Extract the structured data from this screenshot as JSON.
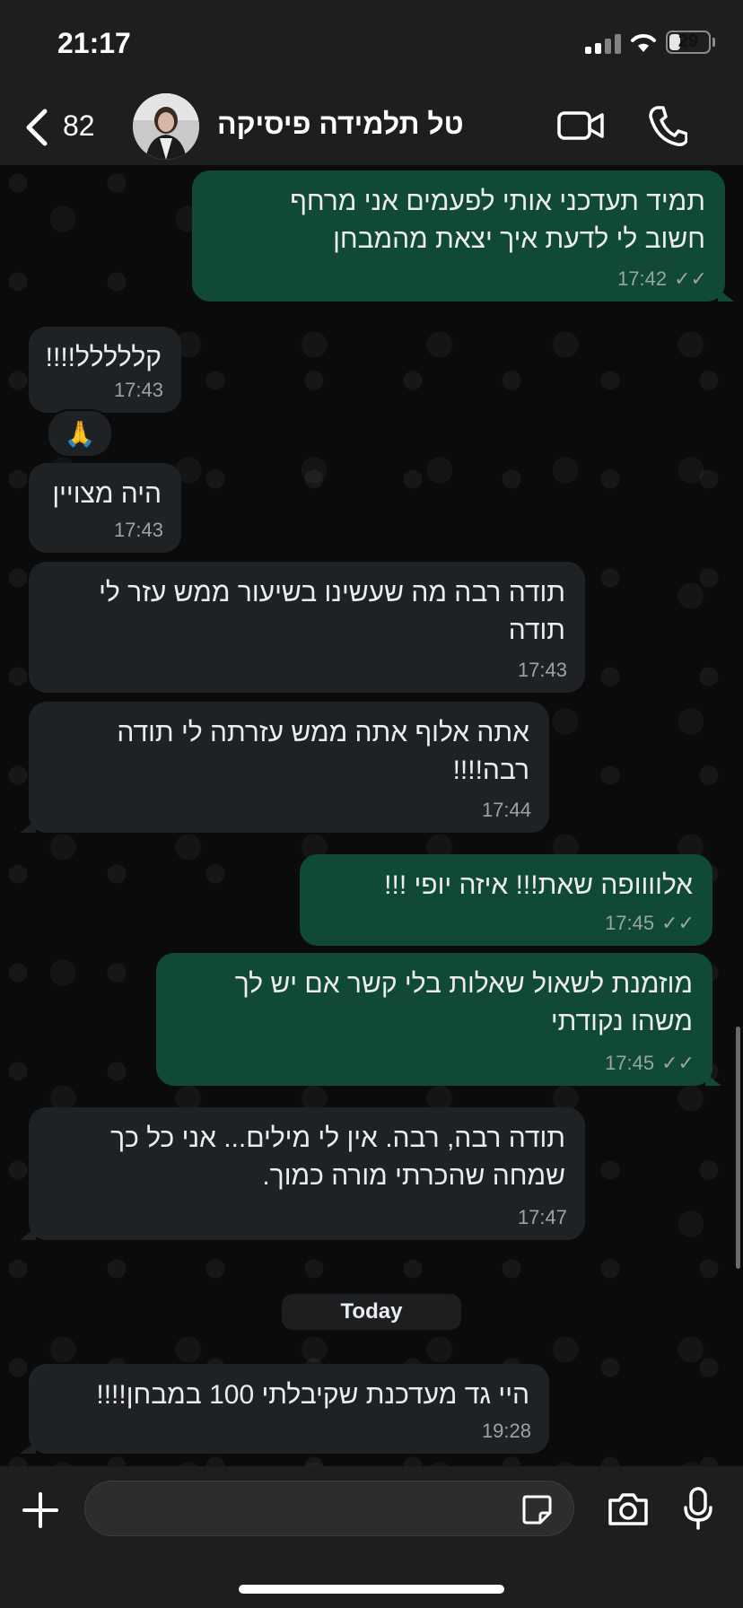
{
  "status_bar": {
    "time": "21:17",
    "battery": "29",
    "battery_level": 0.29
  },
  "header": {
    "back_count": "82",
    "contact_name": "טל תלמידה פיסיקה"
  },
  "messages": [
    {
      "direction": "out",
      "text": "תמיד תעדכני אותי לפעמים אני מרחף\nחשוב לי לדעת איך יצאת מהמבחן",
      "time": "17:42",
      "status": "read"
    },
    {
      "direction": "in",
      "text": "קללללל!!!!",
      "time": "17:43",
      "reaction": "🙏"
    },
    {
      "direction": "in",
      "text": "היה מצויין",
      "time": "17:43"
    },
    {
      "direction": "in",
      "text": "תודה רבה מה שעשינו בשיעור ממש עזר לי\nתודה",
      "time": "17:43"
    },
    {
      "direction": "in",
      "text": "אתה אלוף אתה ממש עזרתה לי תודה\nרבה!!!!",
      "time": "17:44"
    },
    {
      "direction": "out",
      "text": "אלוווופה שאת!!! איזה יופי !!!",
      "time": "17:45",
      "status": "read"
    },
    {
      "direction": "out",
      "text": "מוזמנת לשאול שאלות בלי קשר אם יש לך\nמשהו נקודתי",
      "time": "17:45",
      "status": "read"
    },
    {
      "direction": "in",
      "text": "תודה רבה, רבה. אין לי מילים... אני כל כך\nשמחה שהכרתי מורה כמוך.",
      "time": "17:47"
    },
    {
      "direction": "in",
      "text": "היי גד מעדכנת שקיבלתי 100 במבחן!!!!",
      "time": "19:28"
    }
  ],
  "date_separator": "Today",
  "colors": {
    "outgoing_bubble": "#104934",
    "incoming_bubble": "#1f2224",
    "bar_background": "#1c1e1f"
  },
  "icons": {
    "back": "chevron-left-icon",
    "video": "video-camera-icon",
    "phone": "phone-icon",
    "plus": "plus-icon",
    "sticker": "sticker-icon",
    "camera": "camera-icon",
    "mic": "microphone-icon"
  }
}
